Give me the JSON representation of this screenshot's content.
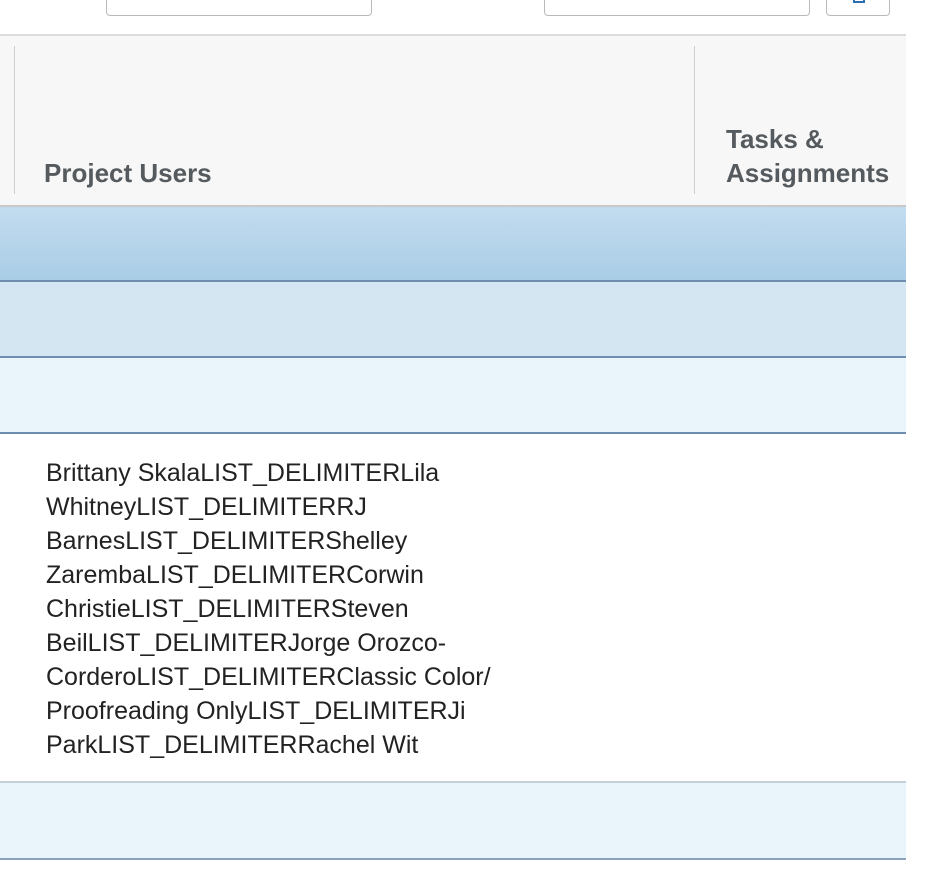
{
  "table": {
    "columns": [
      {
        "label": "Project Users"
      },
      {
        "label": "Tasks & Assignments"
      }
    ],
    "rows": [
      {
        "project_users": "",
        "tasks_assignments": ""
      },
      {
        "project_users": "",
        "tasks_assignments": ""
      },
      {
        "project_users": "",
        "tasks_assignments": ""
      },
      {
        "project_users": "Brittany SkalaLIST_DELIMITERLila WhitneyLIST_DELIMITERRJ BarnesLIST_DELIMITERShelley ZarembaLIST_DELIMITERCorwin ChristieLIST_DELIMITERSteven BeilLIST_DELIMITERJorge Orozco-CorderoLIST_DELIMITERClassic Color/ Proofreading OnlyLIST_DELIMITERJi ParkLIST_DELIMITERRachel Wit",
        "tasks_assignments": ""
      },
      {
        "project_users": "",
        "tasks_assignments": ""
      }
    ]
  },
  "colors": {
    "selected_row": "#a9cde6",
    "alt_row": "#d4e6f2",
    "light_row": "#eaf4fb",
    "header_text": "#555a5e"
  },
  "icons": {
    "toolbar_button": "save-icon"
  }
}
